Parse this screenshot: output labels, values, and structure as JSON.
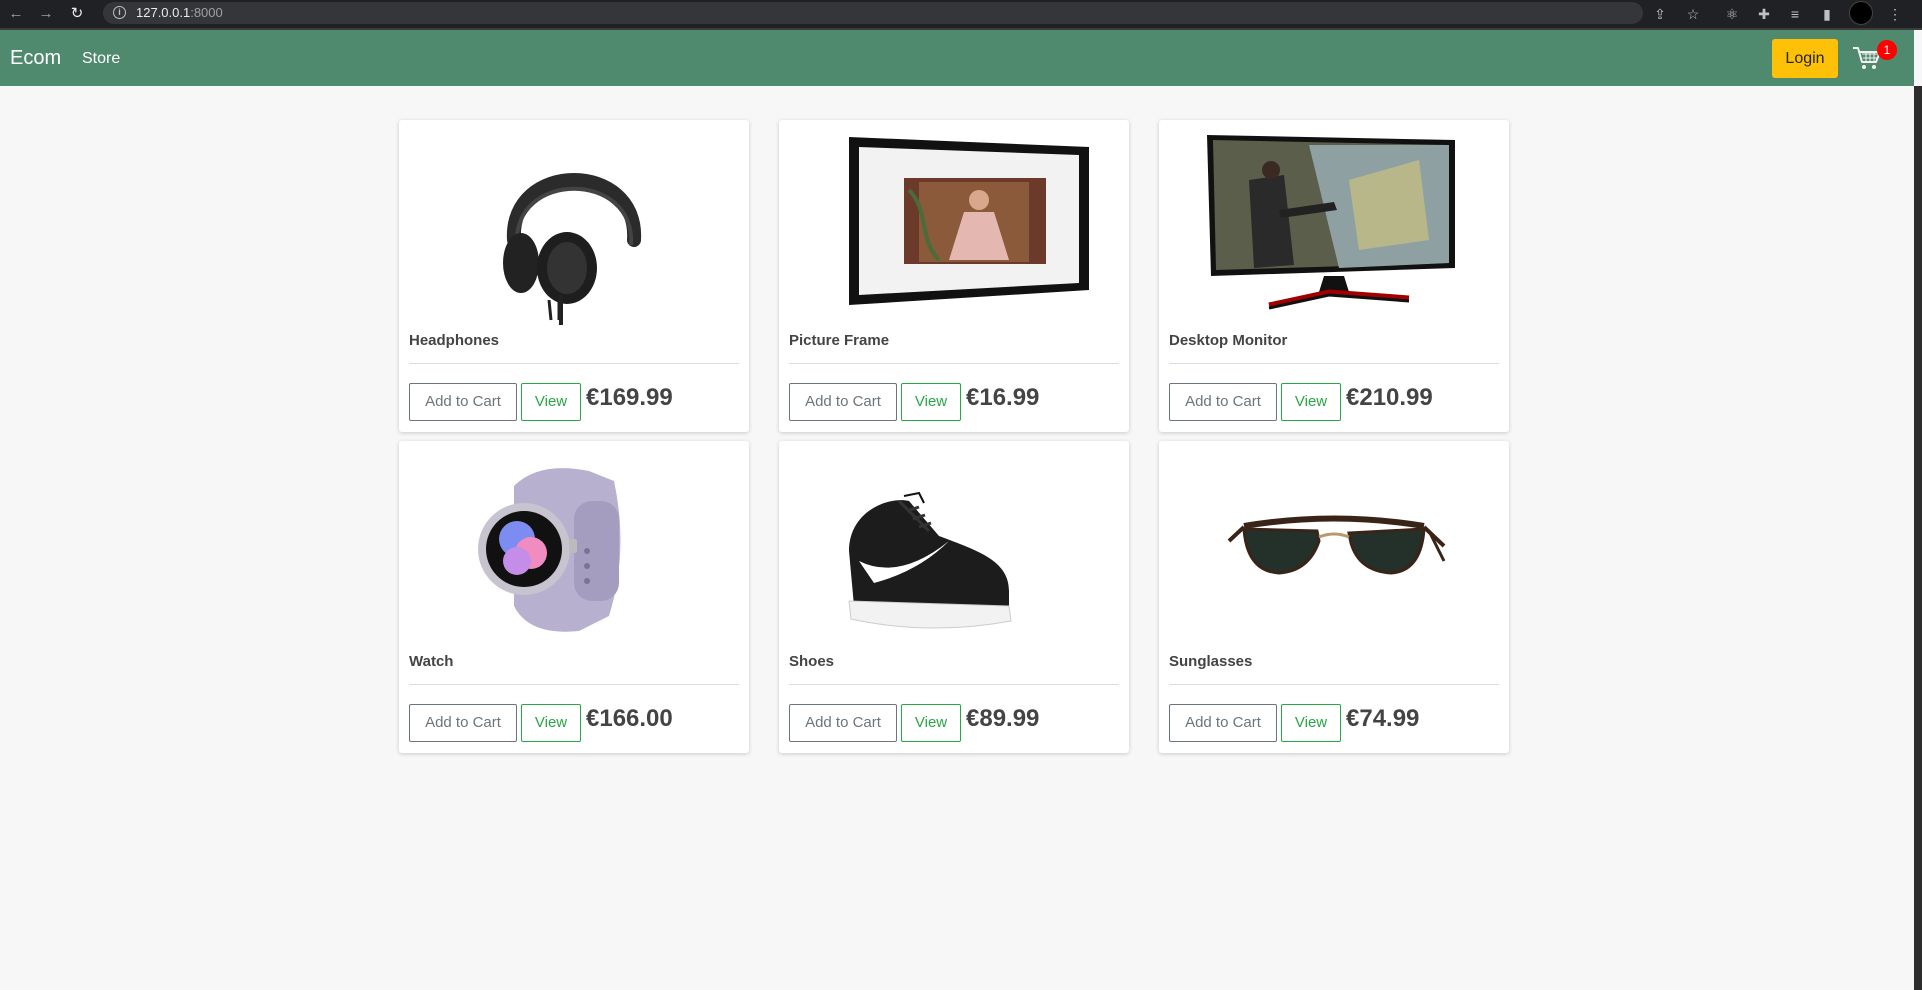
{
  "browser": {
    "url_host": "127.0.0.1",
    "url_port": ":8000"
  },
  "navbar": {
    "brand": "Ecom",
    "store_link": "Store",
    "login_label": "Login",
    "cart_count": "1"
  },
  "products": [
    {
      "name": "Headphones",
      "price": "€169.99",
      "add_label": "Add to Cart",
      "view_label": "View"
    },
    {
      "name": "Picture Frame",
      "price": "€16.99",
      "add_label": "Add to Cart",
      "view_label": "View"
    },
    {
      "name": "Desktop Monitor",
      "price": "€210.99",
      "add_label": "Add to Cart",
      "view_label": "View"
    },
    {
      "name": "Watch",
      "price": "€166.00",
      "add_label": "Add to Cart",
      "view_label": "View"
    },
    {
      "name": "Shoes",
      "price": "€89.99",
      "add_label": "Add to Cart",
      "view_label": "View"
    },
    {
      "name": "Sunglasses",
      "price": "€74.99",
      "add_label": "Add to Cart",
      "view_label": "View"
    }
  ],
  "colors": {
    "navbar": "#4f8a6f",
    "login_button": "#ffc107",
    "view_button": "#28a745",
    "cart_badge": "#ff0000"
  },
  "icons": [
    "back-icon",
    "forward-icon",
    "reload-icon",
    "info-icon",
    "share-icon",
    "star-icon",
    "react-icon",
    "extensions-icon",
    "reading-list-icon",
    "side-panel-icon",
    "menu-icon",
    "cart-icon"
  ]
}
